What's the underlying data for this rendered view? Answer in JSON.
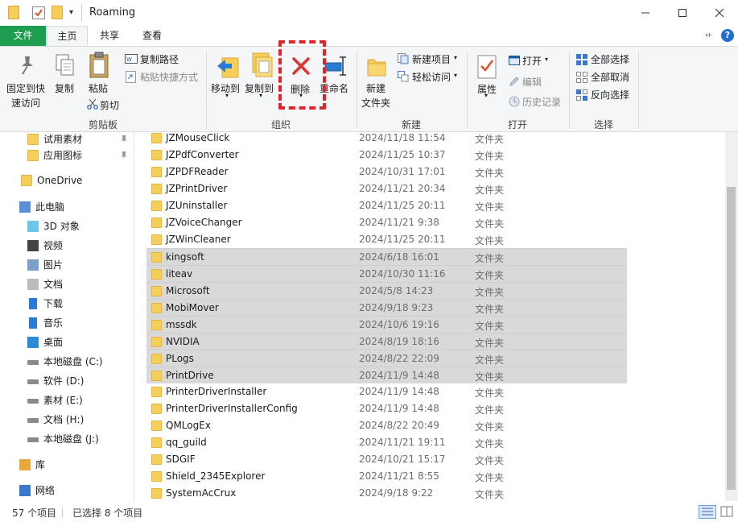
{
  "window": {
    "title": "Roaming"
  },
  "tabs": {
    "file": "文件",
    "home": "主页",
    "share": "共享",
    "view": "查看"
  },
  "ribbon": {
    "pin_quick_access": [
      "固定到快",
      "速访问"
    ],
    "copy": "复制",
    "paste": "粘贴",
    "copy_path": "复制路径",
    "paste_shortcut": "粘贴快捷方式",
    "cut": "剪切",
    "group_clipboard": "剪贴板",
    "move_to": "移动到",
    "copy_to": "复制到",
    "delete": "删除",
    "rename": "重命名",
    "group_organize": "组织",
    "new_folder": [
      "新建",
      "文件夹"
    ],
    "new_item": "新建项目",
    "easy_access": "轻松访问",
    "group_new": "新建",
    "properties": "属性",
    "open": "打开",
    "edit": "编辑",
    "history": "历史记录",
    "group_open": "打开",
    "select_all": "全部选择",
    "select_none": "全部取消",
    "invert_selection": "反向选择",
    "group_select": "选择"
  },
  "nav": {
    "items": [
      {
        "label": "试用素材",
        "icon": "folder-icon",
        "pinned": true
      },
      {
        "label": "应用图标",
        "icon": "folder-icon",
        "pinned": true
      },
      {
        "label": "OneDrive",
        "icon": "folder-icon"
      },
      {
        "label": "此电脑",
        "icon": "computer-icon"
      },
      {
        "label": "3D 对象",
        "icon": "cube-icon"
      },
      {
        "label": "视频",
        "icon": "video-icon"
      },
      {
        "label": "图片",
        "icon": "picture-icon"
      },
      {
        "label": "文档",
        "icon": "document-icon"
      },
      {
        "label": "下载",
        "icon": "download-icon"
      },
      {
        "label": "音乐",
        "icon": "music-icon"
      },
      {
        "label": "桌面",
        "icon": "desktop-icon"
      },
      {
        "label": "本地磁盘 (C:)",
        "icon": "drive-icon"
      },
      {
        "label": "软件 (D:)",
        "icon": "drive-icon"
      },
      {
        "label": "素材 (E:)",
        "icon": "drive-icon"
      },
      {
        "label": "文档 (H:)",
        "icon": "drive-icon"
      },
      {
        "label": "本地磁盘 (J:)",
        "icon": "drive-icon"
      },
      {
        "label": "库",
        "icon": "library-icon"
      },
      {
        "label": "网络",
        "icon": "network-icon"
      }
    ]
  },
  "files": [
    {
      "name": "JZMouseClick",
      "date": "2024/11/18 11:54",
      "type": "文件夹",
      "selected": false
    },
    {
      "name": "JZPdfConverter",
      "date": "2024/11/25 10:37",
      "type": "文件夹",
      "selected": false
    },
    {
      "name": "JZPDFReader",
      "date": "2024/10/31 17:01",
      "type": "文件夹",
      "selected": false
    },
    {
      "name": "JZPrintDriver",
      "date": "2024/11/21 20:34",
      "type": "文件夹",
      "selected": false
    },
    {
      "name": "JZUninstaller",
      "date": "2024/11/25 20:11",
      "type": "文件夹",
      "selected": false
    },
    {
      "name": "JZVoiceChanger",
      "date": "2024/11/21 9:38",
      "type": "文件夹",
      "selected": false
    },
    {
      "name": "JZWinCleaner",
      "date": "2024/11/25 20:11",
      "type": "文件夹",
      "selected": false
    },
    {
      "name": "kingsoft",
      "date": "2024/6/18 16:01",
      "type": "文件夹",
      "selected": true
    },
    {
      "name": "liteav",
      "date": "2024/10/30 11:16",
      "type": "文件夹",
      "selected": true
    },
    {
      "name": "Microsoft",
      "date": "2024/5/8 14:23",
      "type": "文件夹",
      "selected": true
    },
    {
      "name": "MobiMover",
      "date": "2024/9/18 9:23",
      "type": "文件夹",
      "selected": true
    },
    {
      "name": "mssdk",
      "date": "2024/10/6 19:16",
      "type": "文件夹",
      "selected": true
    },
    {
      "name": "NVIDIA",
      "date": "2024/8/19 18:16",
      "type": "文件夹",
      "selected": true
    },
    {
      "name": "PLogs",
      "date": "2024/8/22 22:09",
      "type": "文件夹",
      "selected": true
    },
    {
      "name": "PrintDrive",
      "date": "2024/11/9 14:48",
      "type": "文件夹",
      "selected": true
    },
    {
      "name": "PrinterDriverInstaller",
      "date": "2024/11/9 14:48",
      "type": "文件夹",
      "selected": false
    },
    {
      "name": "PrinterDriverInstallerConfig",
      "date": "2024/11/9 14:48",
      "type": "文件夹",
      "selected": false
    },
    {
      "name": "QMLogEx",
      "date": "2024/8/22 20:49",
      "type": "文件夹",
      "selected": false
    },
    {
      "name": "qq_guild",
      "date": "2024/11/21 19:11",
      "type": "文件夹",
      "selected": false
    },
    {
      "name": "SDGIF",
      "date": "2024/10/21 15:17",
      "type": "文件夹",
      "selected": false
    },
    {
      "name": "Shield_2345Explorer",
      "date": "2024/11/21 8:55",
      "type": "文件夹",
      "selected": false
    },
    {
      "name": "SystemAcCrux",
      "date": "2024/9/18 9:22",
      "type": "文件夹",
      "selected": false
    }
  ],
  "status": {
    "count": "57 个项目",
    "selected": "已选择 8 个项目"
  },
  "colors": {
    "file_tab": "#1f9e52",
    "selection": "#d9d9d9",
    "highlight": "#e2232a",
    "folder": "#f5cf5a"
  }
}
